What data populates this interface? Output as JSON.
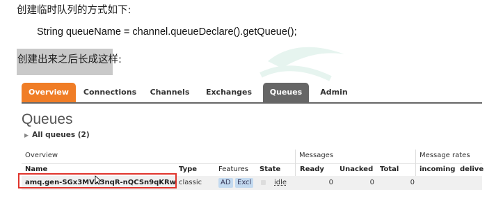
{
  "doc": {
    "line1": "创建临时队列的方式如下:",
    "code": "String queueName = channel.queueDeclare().getQueue();",
    "line2": "创建出来之后长成这样:"
  },
  "nav": {
    "tabs": [
      {
        "label": "Overview",
        "state": "orange"
      },
      {
        "label": "Connections"
      },
      {
        "label": "Channels"
      },
      {
        "label": "Exchanges"
      },
      {
        "label": "Queues",
        "state": "active"
      },
      {
        "label": "Admin"
      }
    ]
  },
  "queues": {
    "title": "Queues",
    "all_label": "All queues (2)",
    "groups": {
      "overview": "Overview",
      "messages": "Messages",
      "rates": "Message rates"
    },
    "headers": {
      "name": "Name",
      "type": "Type",
      "features": "Features",
      "state": "State",
      "ready": "Ready",
      "unacked": "Unacked",
      "total": "Total",
      "incoming": "incoming",
      "deliver": "delive"
    },
    "row": {
      "name": "amq.gen-SGx3MVK3nqR-nQCSn9qKRw",
      "type": "classic",
      "features": [
        "AD",
        "Excl"
      ],
      "state": "idle",
      "ready": "0",
      "unacked": "0",
      "total": "0"
    }
  },
  "colors": {
    "accent": "#f07d26",
    "active_tab": "#666666",
    "highlight_box": "#e0342c"
  }
}
